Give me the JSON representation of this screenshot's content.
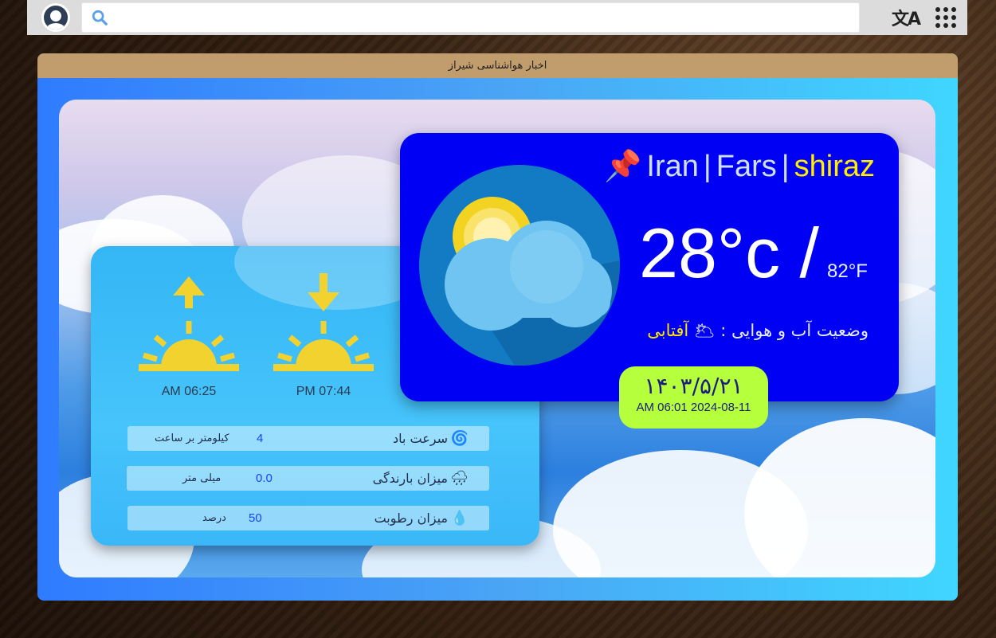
{
  "topbar": {
    "search_placeholder": "",
    "search_value": "",
    "icons": [
      "avatar-icon",
      "search-icon",
      "translate-icon",
      "apps-grid-icon"
    ],
    "translate_glyph": "文A"
  },
  "panel": {
    "title": "اخبار هواشناسی شیراز"
  },
  "location": {
    "country": "Iran",
    "separator": "|",
    "province": "Fars",
    "city": "shiraz",
    "pin_icon": "📌"
  },
  "temperature": {
    "celsius": "28°c /",
    "fahrenheit": "82°F"
  },
  "condition": {
    "label": "وضعیت آب و هوایی :",
    "icon": "🌥",
    "value": "آفتابی"
  },
  "date": {
    "persian": "۱۴۰۳/۵/۲۱",
    "gregorian": "AM 06:01 2024-08-11"
  },
  "sun": {
    "sunrise_time": "AM 06:25",
    "sunset_time": "PM 07:44"
  },
  "stats": [
    {
      "icon": "🌀",
      "label": "سرعت باد",
      "value": "4",
      "unit": "کیلومتر بر ساعت"
    },
    {
      "icon": "🌧",
      "label": "میزان بارندگی",
      "value": "0.0",
      "unit": "میلی متر"
    },
    {
      "icon": "💧",
      "label": "میزان رطوبت",
      "value": "50",
      "unit": "درصد"
    }
  ],
  "colors": {
    "topbar": "#dcdcdc",
    "panel_header": "#c19c6c",
    "main_card": "#0000f5",
    "city": "#ffee00",
    "date_badge": "#b6ff3c",
    "sun": "#f2d22e"
  }
}
